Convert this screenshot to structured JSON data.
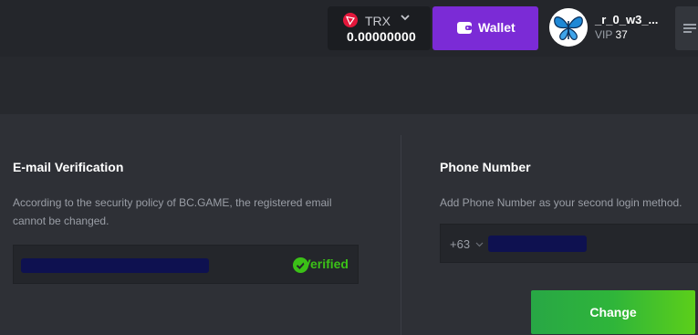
{
  "header": {
    "currency": "TRX",
    "balance": "0.00000000",
    "wallet_label": "Wallet",
    "username": "_r_0_w3_...",
    "vip_label": "VIP",
    "vip_level": "37"
  },
  "email_section": {
    "title": "E-mail Verification",
    "description_line1": "According to the security policy of BC.GAME, the registered email",
    "description_line2": "cannot be changed.",
    "status": "Verified",
    "status_color": "#3bc117"
  },
  "phone_section": {
    "title": "Phone Number",
    "description": "Add Phone Number as your second login method.",
    "country_code": "+63",
    "button_label": "Change"
  },
  "colors": {
    "wallet_button": "#7b2bd6",
    "change_button": "#2fb53a",
    "trx_red": "#e4173b"
  },
  "icons": [
    "trx-icon",
    "chevron-down-icon",
    "wallet-icon",
    "avatar",
    "menu-icon",
    "check-circle-icon"
  ]
}
